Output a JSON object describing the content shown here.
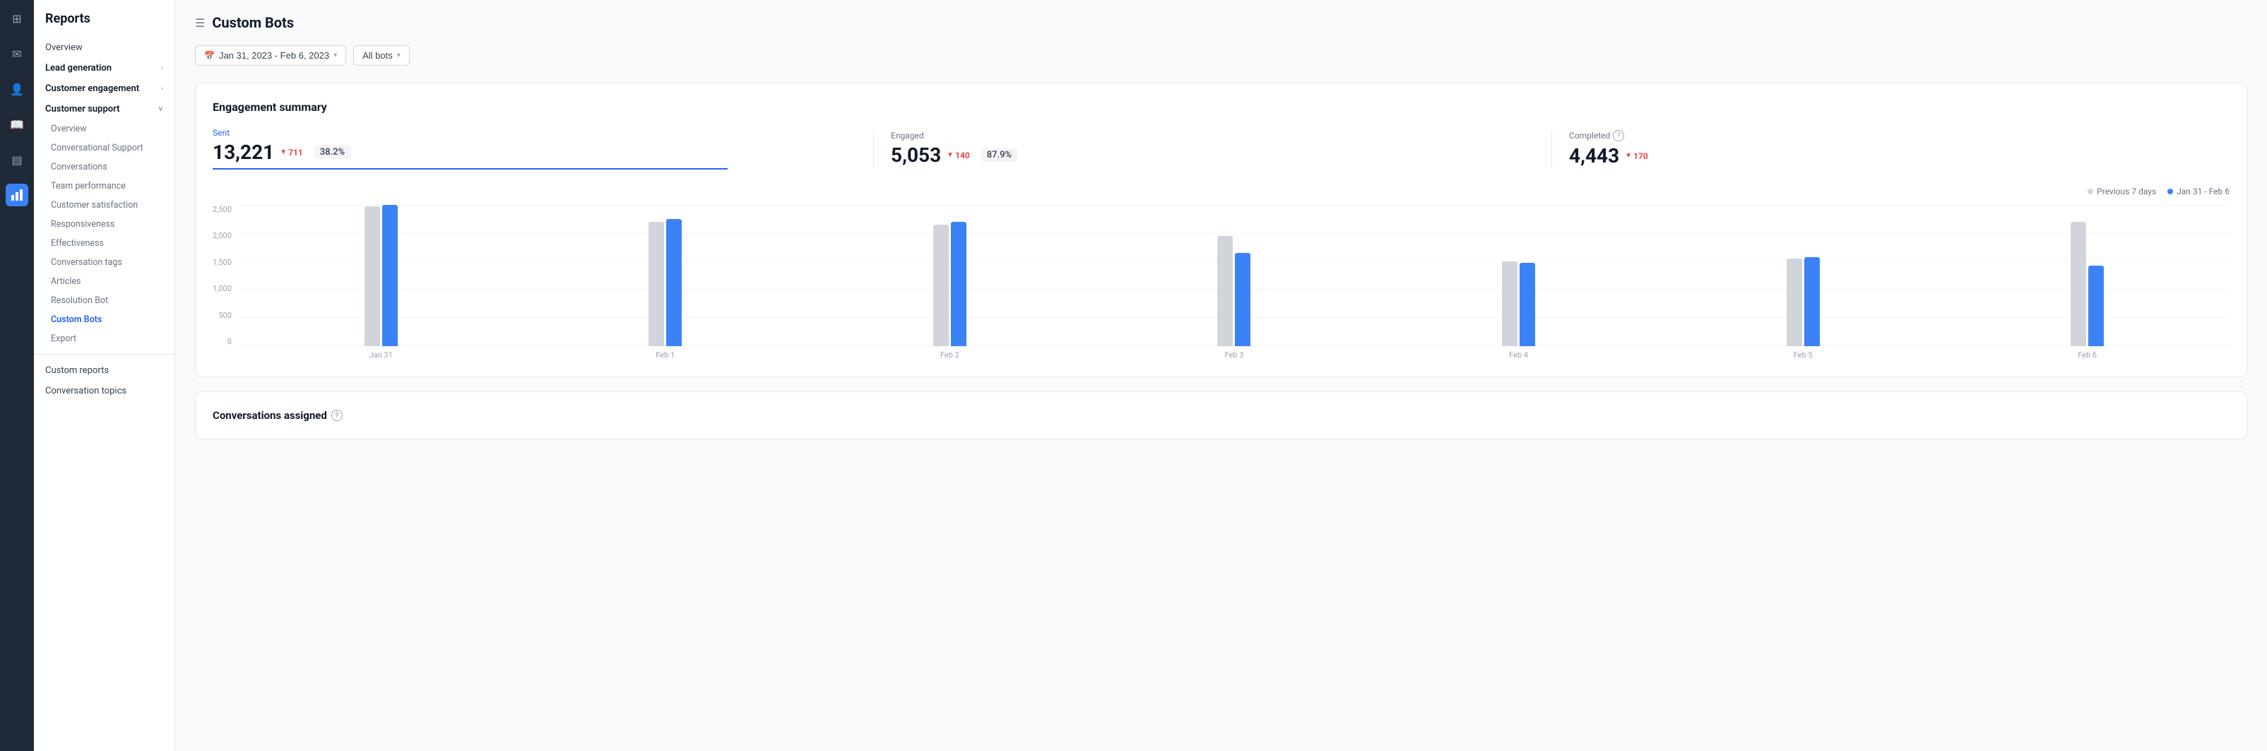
{
  "app": {
    "title": "Reports"
  },
  "icon_sidebar": {
    "icons": [
      {
        "name": "grid-icon",
        "glyph": "⊞",
        "active": false
      },
      {
        "name": "message-icon",
        "glyph": "💬",
        "active": false
      },
      {
        "name": "users-icon",
        "glyph": "👥",
        "active": false
      },
      {
        "name": "book-icon",
        "glyph": "📖",
        "active": false
      },
      {
        "name": "inbox-icon",
        "glyph": "📥",
        "active": false
      },
      {
        "name": "chart-icon",
        "glyph": "📊",
        "active": true
      }
    ]
  },
  "sidebar": {
    "title": "Reports",
    "items": [
      {
        "label": "Overview",
        "type": "top",
        "active": false
      },
      {
        "label": "Lead generation",
        "type": "section",
        "active": false,
        "hasChevron": true
      },
      {
        "label": "Customer engagement",
        "type": "section",
        "active": false,
        "hasChevron": true
      },
      {
        "label": "Customer support",
        "type": "section",
        "active": false,
        "hasChevron": true
      }
    ],
    "sub_items": [
      {
        "label": "Overview",
        "active": false
      },
      {
        "label": "Conversational Support",
        "active": false
      },
      {
        "label": "Conversations",
        "active": false
      },
      {
        "label": "Team performance",
        "active": false
      },
      {
        "label": "Customer satisfaction",
        "active": false
      },
      {
        "label": "Responsiveness",
        "active": false
      },
      {
        "label": "Effectiveness",
        "active": false
      },
      {
        "label": "Conversation tags",
        "active": false
      },
      {
        "label": "Articles",
        "active": false
      },
      {
        "label": "Resolution Bot",
        "active": false
      },
      {
        "label": "Custom Bots",
        "active": true
      },
      {
        "label": "Export",
        "active": false
      }
    ],
    "bottom_items": [
      {
        "label": "Custom reports",
        "active": false
      },
      {
        "label": "Conversation topics",
        "active": false
      }
    ]
  },
  "page": {
    "title": "Custom Bots"
  },
  "filters": {
    "date_range": "Jan 31, 2023 - Feb 6, 2023",
    "bot_filter": "All bots",
    "calendar_icon": "📅",
    "chevron": "▾"
  },
  "engagement_summary": {
    "title": "Engagement summary",
    "stats": [
      {
        "label": "Sent",
        "value": "13,221",
        "change": "711",
        "direction": "down",
        "percent": "38.2%",
        "has_underline": true,
        "label_color": "blue"
      },
      {
        "label": "Engaged",
        "value": "5,053",
        "change": "140",
        "direction": "down",
        "percent": "87.9%",
        "has_underline": false,
        "label_color": "gray"
      },
      {
        "label": "Completed",
        "value": "4,443",
        "change": "170",
        "direction": "down",
        "percent": null,
        "has_underline": false,
        "label_color": "gray",
        "has_info": true
      }
    ],
    "legend": {
      "previous": "Previous 7 days",
      "current": "Jan 31 - Feb 6"
    },
    "chart": {
      "y_labels": [
        "2,500",
        "2,000",
        "1,500",
        "1,000",
        "500",
        "0"
      ],
      "max": 2500,
      "groups": [
        {
          "label": "Jan 31",
          "prev": 2480,
          "curr": 2500
        },
        {
          "label": "Feb 1",
          "prev": 2200,
          "curr": 2250
        },
        {
          "label": "Feb 2",
          "prev": 2150,
          "curr": 2200
        },
        {
          "label": "Feb 3",
          "prev": 1950,
          "curr": 1650
        },
        {
          "label": "Feb 4",
          "prev": 1500,
          "curr": 1480
        },
        {
          "label": "Feb 5",
          "prev": 1550,
          "curr": 1580
        },
        {
          "label": "Feb 6",
          "prev": 2200,
          "curr": 1420
        }
      ]
    }
  },
  "conversations_assigned": {
    "title": "Conversations assigned",
    "info_tooltip": "?"
  }
}
